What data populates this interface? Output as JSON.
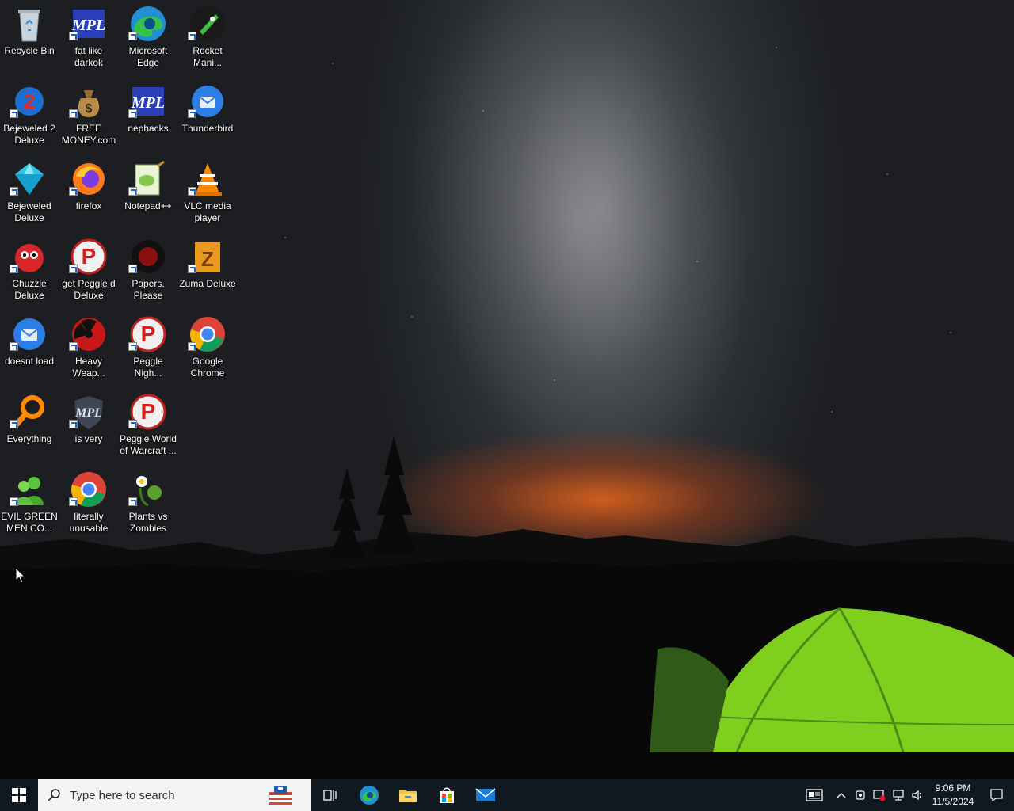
{
  "desktop": {
    "icons": [
      {
        "label": "Recycle Bin",
        "icon": "recycle-bin-icon"
      },
      {
        "label": "fat like darkok",
        "icon": "mpl-icon"
      },
      {
        "label": "Microsoft Edge",
        "icon": "edge-icon"
      },
      {
        "label": "Rocket Mani...",
        "icon": "rocket-icon"
      },
      {
        "label": "Bejeweled 2 Deluxe",
        "icon": "bejeweled2-icon"
      },
      {
        "label": "FREE MONEY.com",
        "icon": "money-bag-icon"
      },
      {
        "label": "nephacks",
        "icon": "mpl-icon"
      },
      {
        "label": "Thunderbird",
        "icon": "thunderbird-icon"
      },
      {
        "label": "Bejeweled Deluxe",
        "icon": "gem-icon"
      },
      {
        "label": "firefox",
        "icon": "firefox-icon"
      },
      {
        "label": "Notepad++",
        "icon": "notepadpp-icon"
      },
      {
        "label": "VLC media player",
        "icon": "vlc-cone-icon"
      },
      {
        "label": "Chuzzle Deluxe",
        "icon": "chuzzle-icon"
      },
      {
        "label": "get Peggle d Deluxe",
        "icon": "peggle-icon"
      },
      {
        "label": "Papers, Please",
        "icon": "papers-please-icon"
      },
      {
        "label": "Zuma Deluxe",
        "icon": "zuma-icon"
      },
      {
        "label": "doesnt load",
        "icon": "thunderbird-icon"
      },
      {
        "label": "Heavy Weap...",
        "icon": "radiation-icon"
      },
      {
        "label": "Peggle Nigh...",
        "icon": "peggle-icon"
      },
      {
        "label": "Google Chrome",
        "icon": "chrome-icon"
      },
      {
        "label": "Everything",
        "icon": "magnifier-icon"
      },
      {
        "label": "is very",
        "icon": "shield-icon"
      },
      {
        "label": "Peggle World of Warcraft ...",
        "icon": "peggle-icon"
      },
      {
        "label": "EVIL GREEN MEN CO...",
        "icon": "green-men-icon"
      },
      {
        "label": "literally unusable",
        "icon": "chrome-icon"
      },
      {
        "label": "Plants vs Zombies",
        "icon": "plant-icon"
      }
    ]
  },
  "taskbar": {
    "search_placeholder": "Type here to search",
    "clock_time": "9:06 PM",
    "clock_date": "11/5/2024",
    "pinned": [
      "task-view-icon",
      "edge-icon",
      "file-explorer-icon",
      "store-icon",
      "mail-icon"
    ]
  }
}
